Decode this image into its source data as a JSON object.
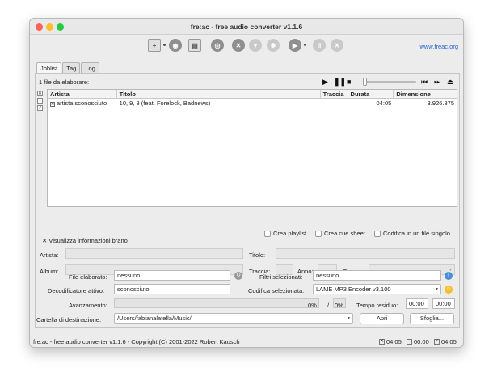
{
  "window": {
    "title": "fre:ac - free audio converter v1.1.6"
  },
  "toolbar": {
    "link": "www.freac.org",
    "icons": [
      "add-files-icon",
      "add-folder-icon",
      "disc-icon",
      "file-icon",
      "cddb-icon",
      "remove-icon",
      "filter-icon",
      "settings-icon",
      "play-icon",
      "pause-icon",
      "stop-icon"
    ]
  },
  "tabs": [
    "Joblist",
    "Tag",
    "Log"
  ],
  "joblist": {
    "status": "1 file da elaborare:",
    "columns": [
      "Artista",
      "Titolo",
      "Traccia",
      "Durata",
      "Dimensione"
    ],
    "rows": [
      {
        "artist": "artista sconosciuto",
        "title": "10, 9, 8 (feat. Forelock, Badnews)",
        "track": "",
        "duration": "04:05",
        "size": "3.926.875"
      }
    ]
  },
  "options": {
    "playlist": "Crea playlist",
    "cue": "Crea cue sheet",
    "single": "Codifica in un file singolo"
  },
  "info": {
    "toggle": "Visualizza informazioni brano",
    "artist": "Artista:",
    "title": "Titolo:",
    "album": "Album:",
    "track": "Traccia:",
    "year": "Anno:",
    "genre": "Genere:"
  },
  "encoder": {
    "file_label": "File elaborato:",
    "file_value": "nessuno",
    "filters_label": "Filtri selezionati:",
    "filters_value": "nessuno",
    "decoder_label": "Decodificatore attivo:",
    "decoder_value": "sconosciuto",
    "codec_label": "Codifica selezionata:",
    "codec_value": "LAME MP3 Encoder v3.100",
    "progress_label": "Avanzamento:",
    "progress_a": "0%",
    "slash": "/",
    "progress_b": "0%",
    "time_label": "Tempo residuo:",
    "time_a": "00:00",
    "time_b": "00:00",
    "dest_label": "Cartella di destinazione:",
    "dest_value": "/Users/fabianalatella/Music/",
    "open_btn": "Apri",
    "browse_btn": "Sfoglia..."
  },
  "statusbar": {
    "text": "fre:ac - free audio converter v1.1.6 - Copyright (C) 2001-2022 Robert Kausch",
    "t1": "04:05",
    "t2": "00:00",
    "t3": "04:05"
  }
}
